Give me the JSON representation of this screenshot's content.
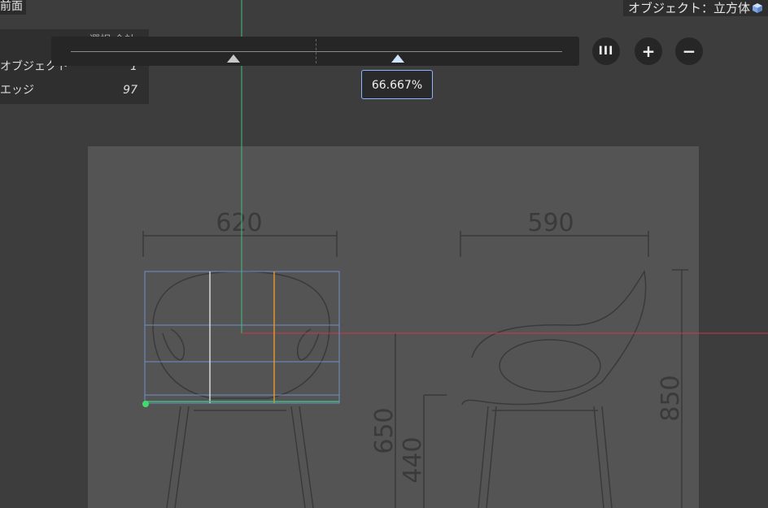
{
  "view": {
    "label": "前面"
  },
  "object": {
    "label": "オブジェクト：立方体",
    "icon": "cube-icon"
  },
  "stats": {
    "header": "選択 合計",
    "rows": [
      {
        "label": "オブジェクト",
        "value": "1"
      },
      {
        "label": "エッジ",
        "value": "97"
      }
    ]
  },
  "zoom": {
    "tooltip": "66.667%",
    "buttons": [
      "III",
      "+",
      "−"
    ]
  },
  "drawing": {
    "dims": [
      "620",
      "590",
      "650",
      "440",
      "850"
    ]
  },
  "colors": {
    "x_axis": "#c8384a",
    "y_axis": "#3fbf7a",
    "selection": "#6f8fc8",
    "edge_orange": "#e0962a",
    "accent": "#8fb4ff"
  }
}
